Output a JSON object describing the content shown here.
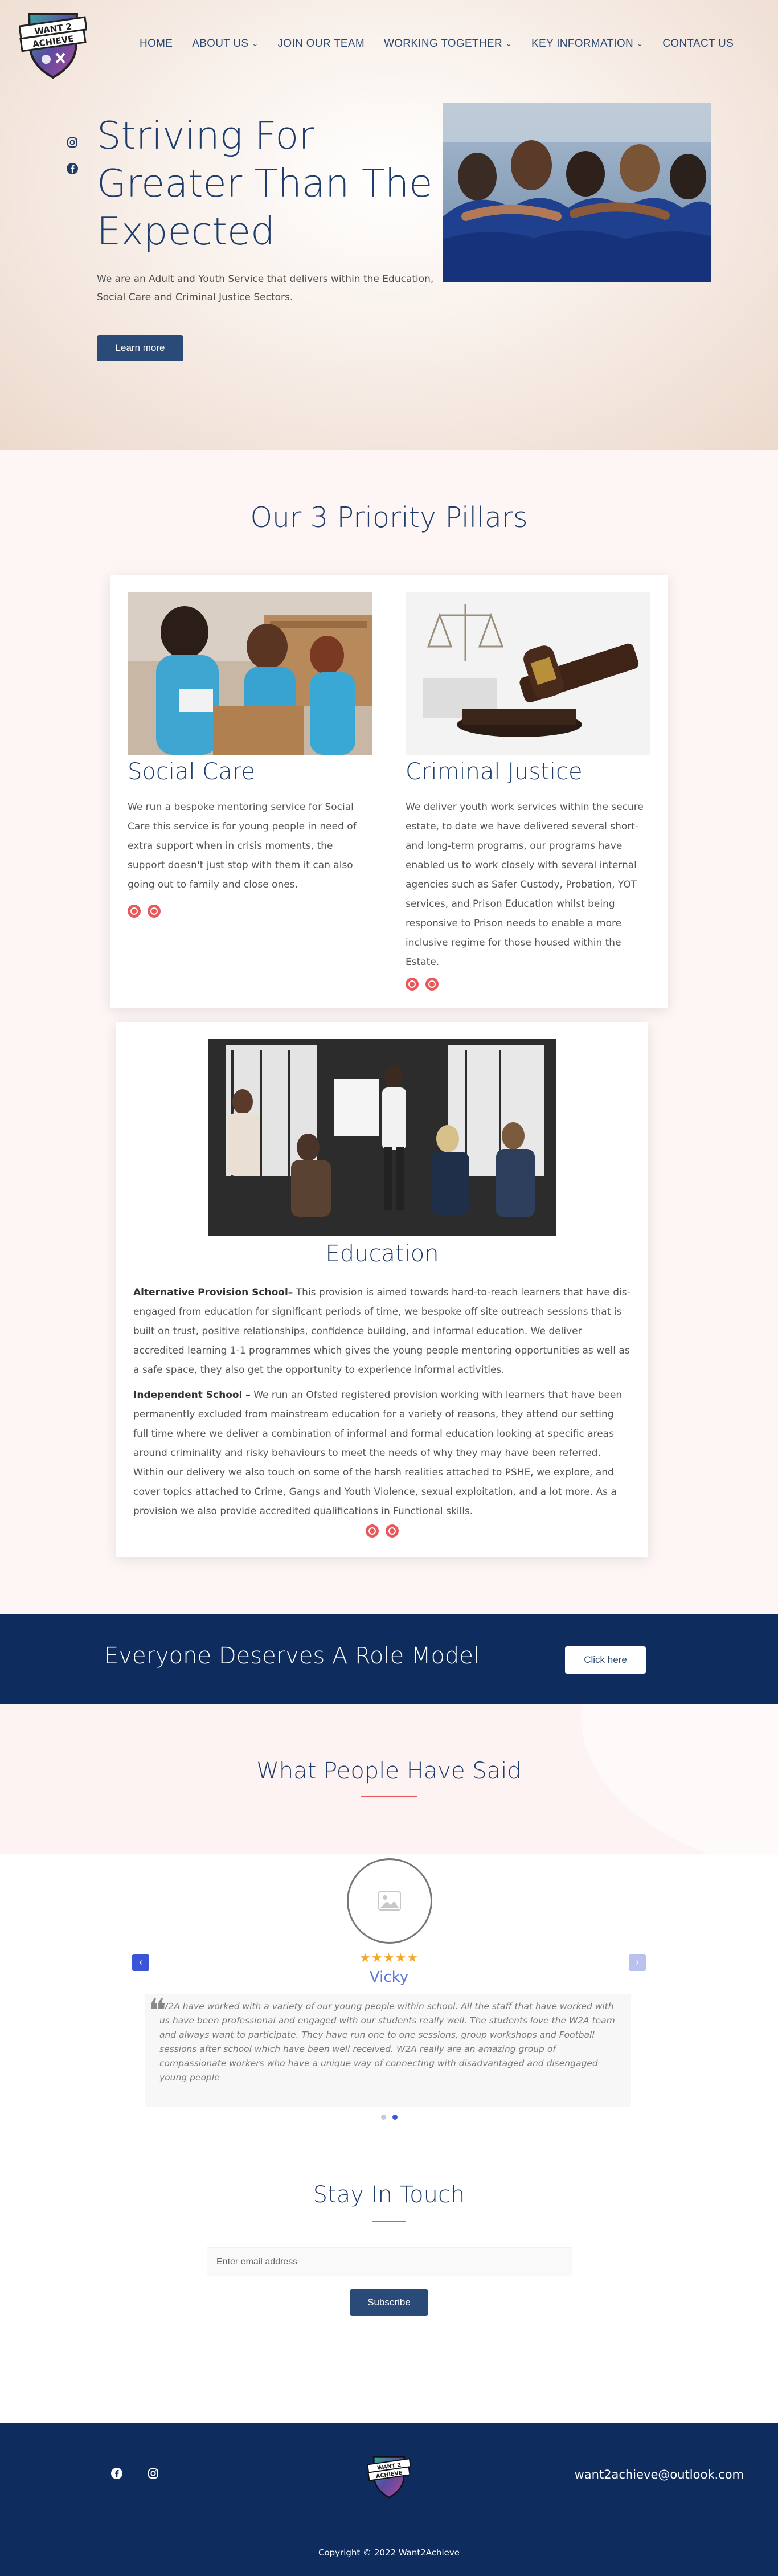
{
  "logo": {
    "text_line1": "WANT 2",
    "text_line2": "ACHIEVE"
  },
  "nav": {
    "items": [
      {
        "label": "HOME",
        "dropdown": false
      },
      {
        "label": "ABOUT US",
        "dropdown": true
      },
      {
        "label": "JOIN OUR TEAM",
        "dropdown": false
      },
      {
        "label": "WORKING TOGETHER",
        "dropdown": true
      },
      {
        "label": "KEY INFORMATION",
        "dropdown": true
      },
      {
        "label": "CONTACT US",
        "dropdown": false
      }
    ]
  },
  "hero": {
    "title": "Striving For Greater Than The Expected",
    "description": "We are an Adult and Youth Service that delivers within the Education, Social Care and Criminal Justice Sectors.",
    "button_label": "Learn more"
  },
  "pillars": {
    "title": "Our 3 Priority Pillars",
    "social_care": {
      "title": "Social Care",
      "text": "We run a bespoke mentoring service for Social Care this service is for young people in need of extra support when in crisis moments, the support doesn't just stop with them it can also going out to family and close ones."
    },
    "criminal_justice": {
      "title": "Criminal Justice",
      "text": "We deliver youth work services within the secure estate, to date we have delivered several short- and long-term programs, our programs have enabled us to work closely with several internal agencies such as Safer Custody, Probation, YOT services, and Prison Education whilst being responsive to Prison needs to enable a more inclusive regime for those housed within the Estate."
    },
    "education": {
      "title": "Education",
      "ap_heading": "Alternative Provision School–",
      "ap_text": " This provision is aimed towards hard-to-reach learners that have dis-engaged from education for significant periods of time, we bespoke off site outreach sessions that is built on trust, positive relationships, confidence building, and informal education. We deliver accredited learning 1-1 programmes which gives the young people mentoring opportunities as well as a safe space, they also get the opportunity to experience informal activities.",
      "is_heading": "Independent School –",
      "is_text": " We run an Ofsted registered provision working with learners that have been permanently excluded from mainstream education for a variety of reasons, they attend our setting full time where we deliver a combination of informal and formal education looking at specific areas around criminality and risky behaviours to meet the needs of why they may have been referred. Within our delivery we also touch on some of the harsh realities attached to PSHE, we explore, and cover topics attached to Crime, Gangs and Youth Violence, sexual exploitation, and a lot more. As a provision we also provide accredited qualifications in Functional skills."
    }
  },
  "role_model": {
    "title": "Everyone Deserves A Role Model",
    "button_label": "Click here"
  },
  "testimonials": {
    "title": "What People Have Said",
    "rating": 5,
    "stars": "★★★★★",
    "name": "Vicky",
    "quote": "W2A have worked with a variety of our young people within school. All the staff that have worked with us have been professional and engaged with our students really well. The students love the W2A team and always want to participate. They have run one to one sessions, group workshops and Football sessions after school which have been well received. W2A really are an amazing group of compassionate workers who have a unique way of connecting with disadvantaged and disengaged young people",
    "slides": 2,
    "active_slide": 2
  },
  "stay_in_touch": {
    "title": "Stay In Touch",
    "email_placeholder": "Enter email address",
    "button_label": "Subscribe"
  },
  "footer": {
    "email": "want2achieve@outlook.com",
    "copyright": "Copyright © 2022 Want2Achieve"
  },
  "colors": {
    "navy": "#0e2d5e",
    "heading_blue": "#1f3d6b",
    "button_blue": "#2a4a78",
    "accent_red": "#e8585a",
    "star_gold": "#f5a623",
    "name_blue": "#5a78d6"
  }
}
